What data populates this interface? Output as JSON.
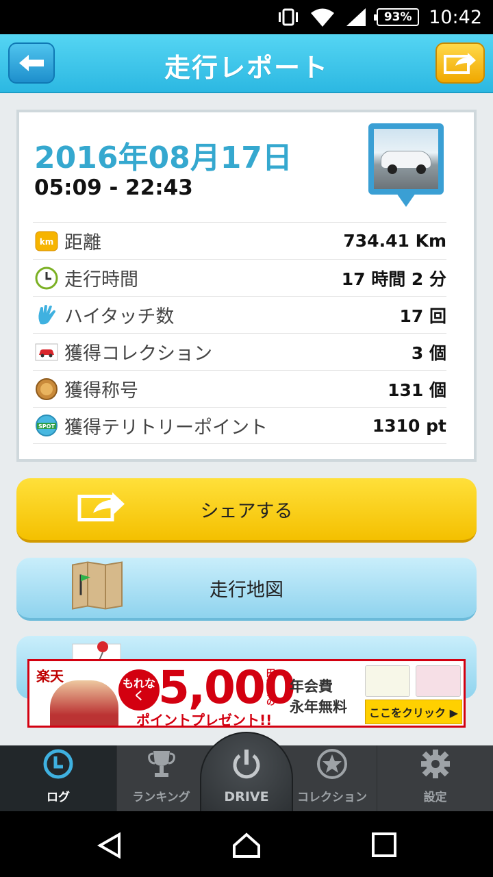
{
  "status_bar": {
    "battery": "93%",
    "time": "10:42"
  },
  "header": {
    "title": "走行レポート"
  },
  "report": {
    "date": "2016年08月17日",
    "time_range": "05:09 - 22:43",
    "rows": [
      {
        "icon": "km-badge-icon",
        "label": "距離",
        "value": "734.41 Km"
      },
      {
        "icon": "clock-icon",
        "label": "走行時間",
        "value": "17 時間 2 分"
      },
      {
        "icon": "high-five-hand-icon",
        "label": "ハイタッチ数",
        "value": "17 回"
      },
      {
        "icon": "car-card-icon",
        "label": "獲得コレクション",
        "value": "3 個"
      },
      {
        "icon": "medal-icon",
        "label": "獲得称号",
        "value": "131 個"
      },
      {
        "icon": "spot-badge-icon",
        "label": "獲得テリトリーポイント",
        "value": "1310 pt"
      }
    ],
    "km_badge_text": "km",
    "spot_badge_text": "SPOT"
  },
  "buttons": {
    "share": "シェアする",
    "map": "走行地図"
  },
  "ad": {
    "logo": "楽天",
    "badge": "もれなく",
    "amount": "5,000",
    "yen_note": "円相当の",
    "subtitle": "ポイントプレゼント!!",
    "fee_line1": "年会費",
    "fee_line2": "永年無料",
    "cta": "ここをクリック ▶"
  },
  "bottom_nav": {
    "log": "ログ",
    "ranking": "ランキング",
    "drive": "DRIVE",
    "collection": "コレクション",
    "settings": "設定"
  },
  "colors": {
    "header_blue": "#2cb8e2",
    "date_blue": "#35a8cf",
    "share_yellow": "#f4c000",
    "map_blue": "#8fd3ee"
  }
}
